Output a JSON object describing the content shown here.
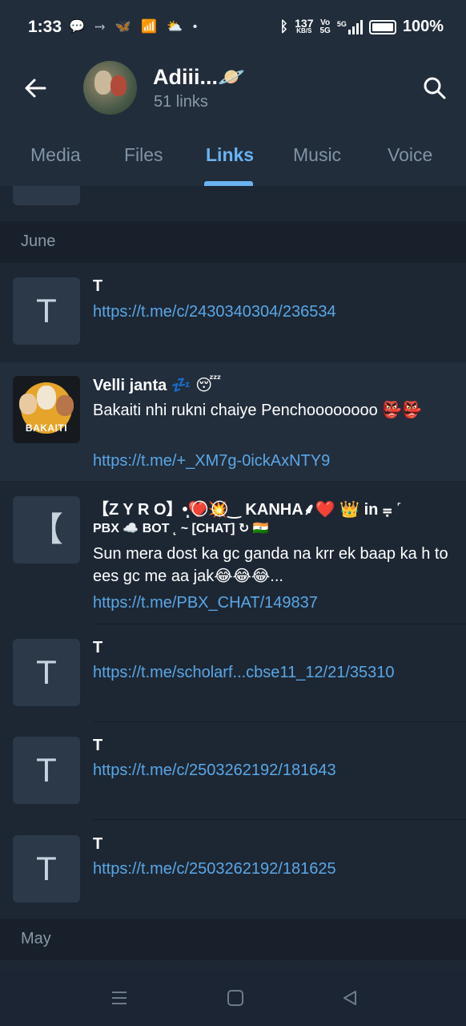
{
  "status_bar": {
    "time": "1:33",
    "net_speed_top": "137",
    "net_speed_unit": "KB/S",
    "volte_top": "Vo",
    "volte_bottom": "5G",
    "signal_label": "5G",
    "battery": "100%"
  },
  "header": {
    "title": "Adiii...🪐",
    "subtitle": "51 links"
  },
  "tabs": [
    {
      "label": "Media"
    },
    {
      "label": "Files"
    },
    {
      "label": "Links"
    },
    {
      "label": "Music"
    },
    {
      "label": "Voice"
    }
  ],
  "active_tab": "Links",
  "sections": [
    {
      "label": "June"
    },
    {
      "label": "May"
    }
  ],
  "links": [
    {
      "thumb_letter": "T",
      "title": "T",
      "description": "",
      "url": "https://t.me/c/2430340304/236534"
    },
    {
      "thumb_letter": "",
      "thumb_caption": "BAKAITI",
      "title": "Velli janta 💤 😴",
      "description": "Bakaiti nhi rukni chaiye Penchoooooooo 👺👺",
      "url": "https://t.me/+_XM7g-0ickAxNTY9"
    },
    {
      "thumb_letter": "【",
      "title": "【Z Y R O】•̩̩͙❤️⃝💥⃝‿ KANHA⸙❤️ 👑 in ⩦ ˹",
      "title2": "PBX ☁️ BOT ˛ ~ [CHAT] ↻ 🇮🇳",
      "description": "Sun mera dost ka gc ganda na krr ek baap ka h to ees gc me aa jak😂😂😂...",
      "url": "https://t.me/PBX_CHAT/149837"
    },
    {
      "thumb_letter": "T",
      "title": "T",
      "description": "",
      "url": "https://t.me/scholarf...cbse11_12/21/35310"
    },
    {
      "thumb_letter": "T",
      "title": "T",
      "description": "",
      "url": "https://t.me/c/2503262192/181643"
    },
    {
      "thumb_letter": "T",
      "title": "T",
      "description": "",
      "url": "https://t.me/c/2503262192/181625"
    }
  ],
  "icons": {
    "back": "back-arrow-icon",
    "search": "search-icon",
    "nav_menu": "menu-icon",
    "nav_home": "home-icon",
    "nav_back": "back-triangle-icon"
  },
  "colors": {
    "accent": "#6ab3f3",
    "link": "#5aa7e6",
    "background": "#1b2533"
  }
}
